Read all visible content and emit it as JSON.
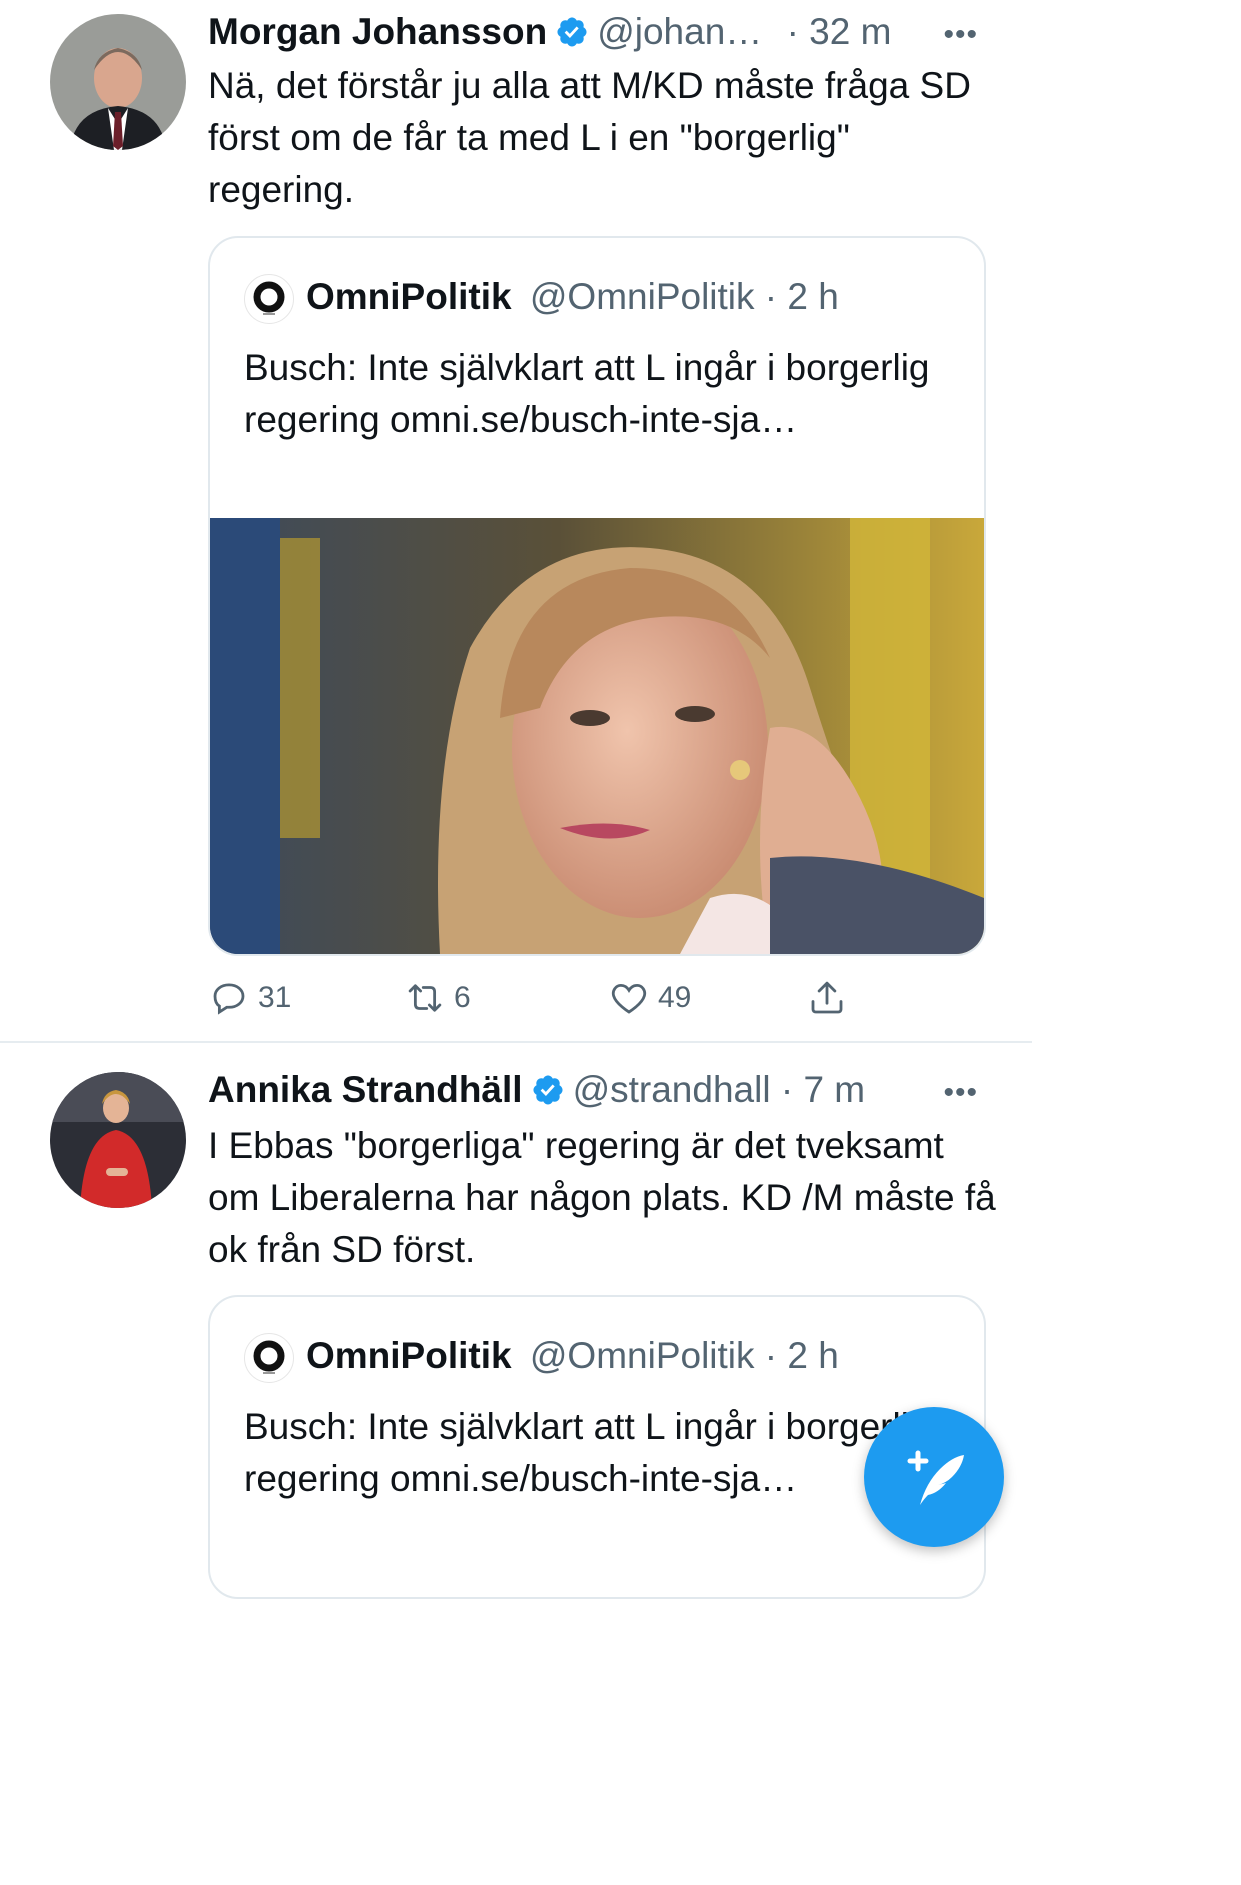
{
  "tweets": [
    {
      "author": "Morgan Johansson",
      "handle": "@johan…",
      "time": "· 32 m",
      "text": "Nä, det förstår ju alla att M/KD måste fråga SD först om de får ta med L i en \"borgerlig\" regering.",
      "quote": {
        "author": "OmniPolitik",
        "handle": "@OmniPolitik",
        "time": "· 2 h",
        "text": "Busch: Inte självklart att L ingår i borgerlig regering omni.se/busch-inte-sja…"
      },
      "actions": {
        "replies": "31",
        "retweets": "6",
        "likes": "49"
      }
    },
    {
      "author": "Annika Strandhäll",
      "handle": "@strandhall",
      "time": "· 7 m",
      "text": "I Ebbas \"borgerliga\" regering är det tveksamt om Liberalerna har någon plats. KD /M måste få ok från SD först.",
      "quote": {
        "author": "OmniPolitik",
        "handle": "@OmniPolitik",
        "time": "· 2 h",
        "text": "Busch: Inte självklart att L ingår i borgerlig regering omni.se/busch-inte-sja…"
      }
    }
  ],
  "icons": {
    "verified": "verified-badge-icon",
    "more": "more-icon",
    "reply": "reply-icon",
    "retweet": "retweet-icon",
    "like": "heart-icon",
    "share": "share-icon",
    "compose": "compose-tweet-icon"
  },
  "colors": {
    "accent": "#1d9bf0",
    "muted": "#536471",
    "border": "#e1e8ed"
  }
}
